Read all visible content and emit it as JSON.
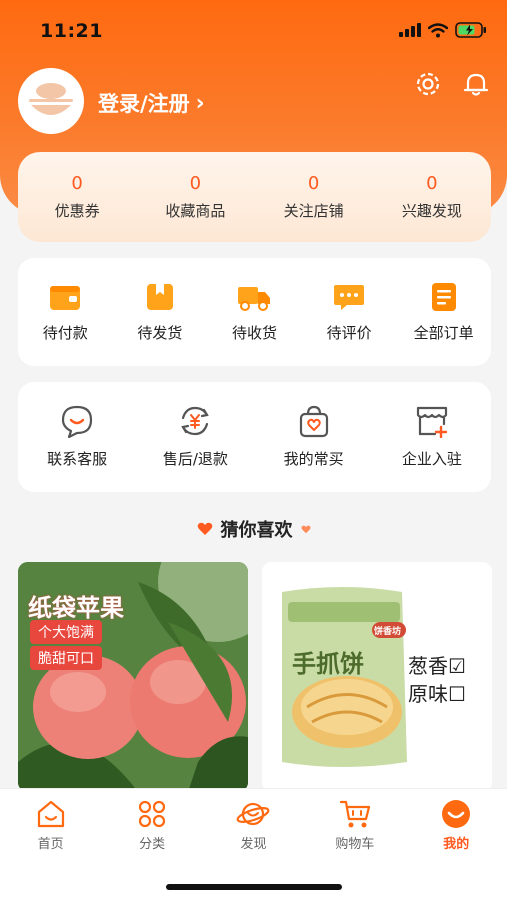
{
  "status_bar": {
    "time": "11:21"
  },
  "header": {
    "login_label": "登录/注册",
    "login_chevron": "›",
    "icons": [
      "gear-icon",
      "bell-icon"
    ]
  },
  "stats": [
    {
      "value": "0",
      "label": "优惠券"
    },
    {
      "value": "0",
      "label": "收藏商品"
    },
    {
      "value": "0",
      "label": "关注店铺"
    },
    {
      "value": "0",
      "label": "兴趣发现"
    }
  ],
  "orders": [
    {
      "label": "待付款",
      "icon": "wallet-icon"
    },
    {
      "label": "待发货",
      "icon": "package-icon"
    },
    {
      "label": "待收货",
      "icon": "truck-icon"
    },
    {
      "label": "待评价",
      "icon": "comment-icon"
    },
    {
      "label": "全部订单",
      "icon": "document-icon"
    }
  ],
  "services": [
    {
      "label": "联系客服",
      "icon": "chat-icon"
    },
    {
      "label": "售后/退款",
      "icon": "refund-icon"
    },
    {
      "label": "我的常买",
      "icon": "shopping-bag-icon"
    },
    {
      "label": "企业入驻",
      "icon": "store-icon"
    }
  ],
  "section_title": "猜你喜欢",
  "products": [
    {
      "title": "纸袋苹果",
      "tags": [
        "个大饱满",
        "脆甜可口"
      ]
    },
    {
      "package_text": "手抓饼",
      "brand": "饼香坊",
      "options": [
        "葱香☑",
        "原味☐"
      ]
    }
  ],
  "tabbar": [
    {
      "label": "首页",
      "icon": "home-icon"
    },
    {
      "label": "分类",
      "icon": "category-icon"
    },
    {
      "label": "发现",
      "icon": "planet-icon"
    },
    {
      "label": "购物车",
      "icon": "cart-icon"
    },
    {
      "label": "我的",
      "icon": "profile-icon",
      "active": true
    }
  ],
  "colors": {
    "brand": "#ff5a1f",
    "header": "#ff6a10",
    "card": "#ffffff",
    "background": "#f4f4f4"
  }
}
